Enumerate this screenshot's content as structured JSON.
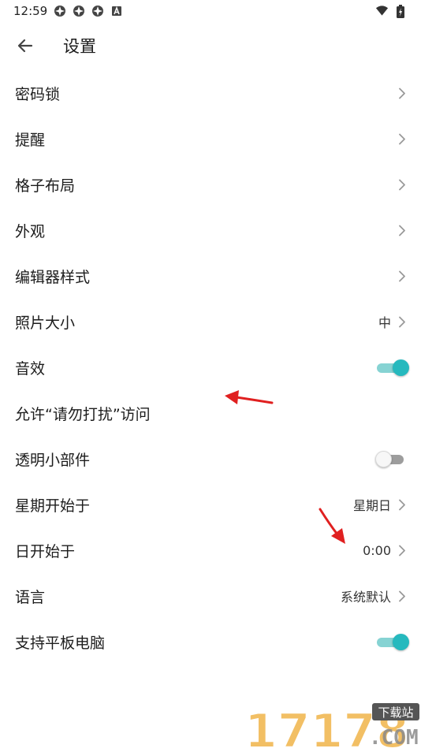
{
  "status_bar": {
    "time": "12:59"
  },
  "header": {
    "title": "设置"
  },
  "colors": {
    "accent": "#26b9be",
    "annotation_arrow": "#e02020"
  },
  "settings": [
    {
      "label": "密码锁",
      "value": "",
      "control": "chevron"
    },
    {
      "label": "提醒",
      "value": "",
      "control": "chevron"
    },
    {
      "label": "格子布局",
      "value": "",
      "control": "chevron"
    },
    {
      "label": "外观",
      "value": "",
      "control": "chevron"
    },
    {
      "label": "编辑器样式",
      "value": "",
      "control": "chevron"
    },
    {
      "label": "照片大小",
      "value": "中",
      "control": "chevron"
    },
    {
      "label": "音效",
      "value": "",
      "control": "switch",
      "on": true
    },
    {
      "label": "允许“请勿打扰”访问",
      "value": "",
      "control": "none"
    },
    {
      "label": "透明小部件",
      "value": "",
      "control": "switch",
      "on": false
    },
    {
      "label": "星期开始于",
      "value": "星期日",
      "control": "chevron"
    },
    {
      "label": "日开始于",
      "value": "0:00",
      "control": "chevron"
    },
    {
      "label": "语言",
      "value": "系统默认",
      "control": "chevron"
    },
    {
      "label": "支持平板电脑",
      "value": "",
      "control": "switch",
      "on": true
    }
  ],
  "watermark": {
    "number": "17178",
    "tag": "下载站",
    "domain": ".COM"
  }
}
